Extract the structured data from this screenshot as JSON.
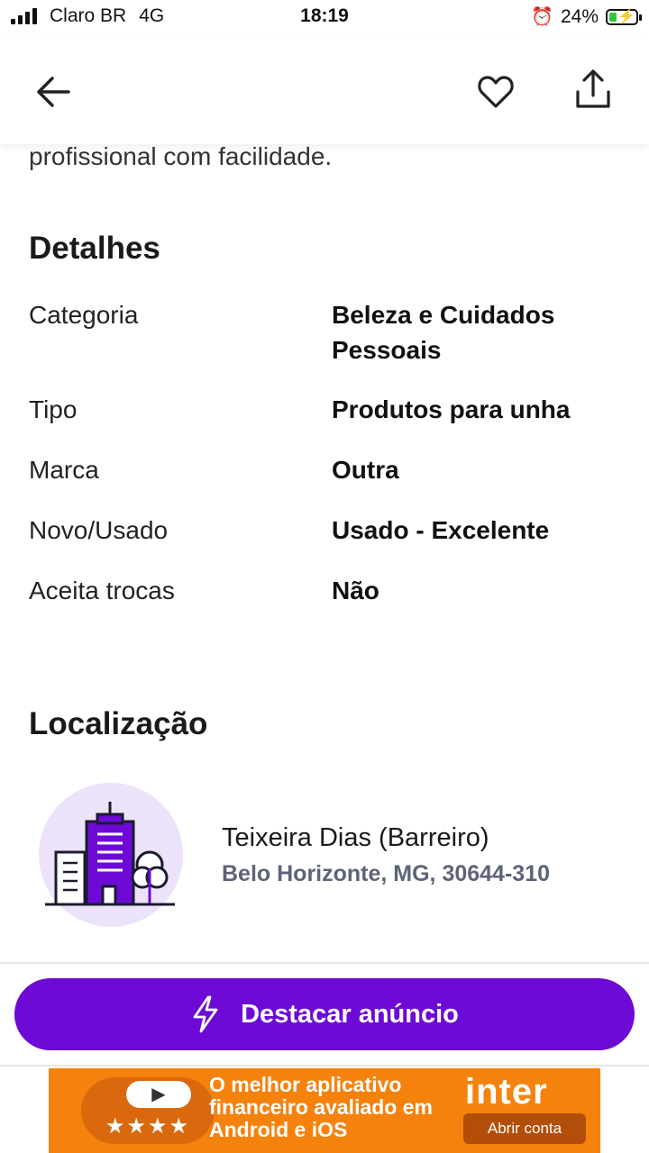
{
  "status_bar": {
    "carrier": "Claro BR",
    "network": "4G",
    "time": "18:19",
    "battery": "24%"
  },
  "description_tail": "profissional com facilidade.",
  "details": {
    "title": "Detalhes",
    "rows": [
      {
        "label": "Categoria",
        "value": "Beleza e Cuidados Pessoais"
      },
      {
        "label": "Tipo",
        "value": "Produtos para unha"
      },
      {
        "label": "Marca",
        "value": "Outra"
      },
      {
        "label": "Novo/Usado",
        "value": "Usado - Excelente"
      },
      {
        "label": "Aceita trocas",
        "value": "Não"
      }
    ]
  },
  "location": {
    "title": "Localização",
    "neighborhood": "Teixeira Dias (Barreiro)",
    "address": "Belo Horizonte, MG, 30644-310"
  },
  "cta": {
    "label": "Destacar anúncio"
  },
  "ad_banner": {
    "stars": "★★★★",
    "text": "O melhor aplicativo financeiro avaliado em Android e iOS",
    "brand": "inter",
    "button": "Abrir conta"
  },
  "colors": {
    "accent": "#6d0ad6",
    "banner": "#f5820d",
    "address": "#5b6478"
  }
}
